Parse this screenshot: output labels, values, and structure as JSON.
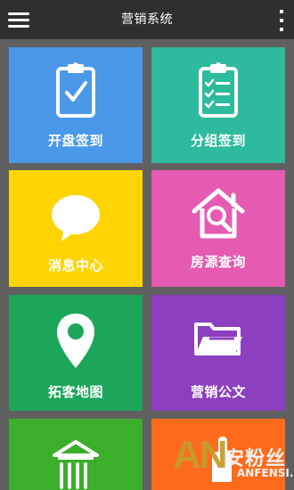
{
  "header": {
    "title": "营销系统",
    "menu_icon": "menu-icon",
    "more_icon": "more-icon"
  },
  "tiles": [
    {
      "label": "开盘签到",
      "icon": "clipboard-check-icon",
      "color": "#4A98E8"
    },
    {
      "label": "分组签到",
      "icon": "clipboard-list-icon",
      "color": "#2DBA9D"
    },
    {
      "label": "消息中心",
      "icon": "chat-bubble-icon",
      "color": "#FFD400"
    },
    {
      "label": "房源查询",
      "icon": "house-search-icon",
      "color": "#E45BB1"
    },
    {
      "label": "拓客地图",
      "icon": "map-pin-icon",
      "color": "#1BA65A"
    },
    {
      "label": "营销公文",
      "icon": "folder-icon",
      "color": "#8C3FBE"
    },
    {
      "label": "",
      "icon": "building-icon",
      "color": "#3BAE2C"
    },
    {
      "label": "",
      "icon": "hand-icon",
      "color": "#FF6B1A"
    }
  ],
  "watermark": {
    "brand": "AN",
    "cn_text": "安粉丝",
    "site": "ANFENSI.COM"
  }
}
